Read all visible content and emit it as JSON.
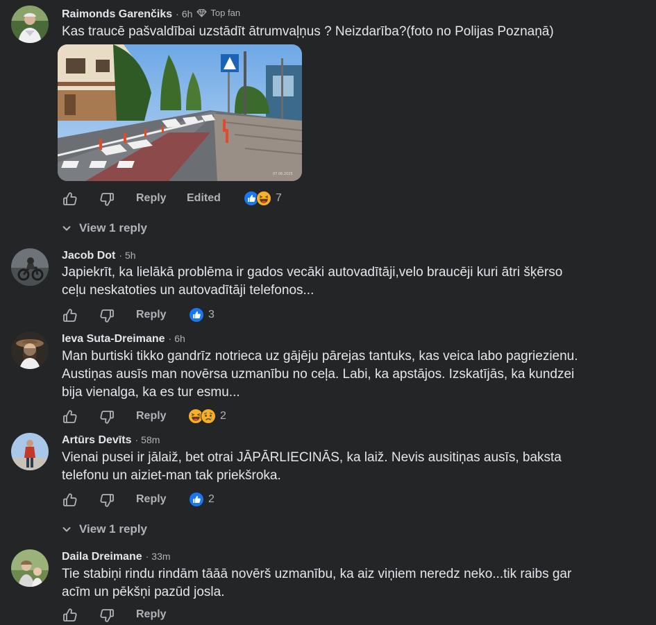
{
  "comments": [
    {
      "author": "Raimonds Garenčiks",
      "time": "6h",
      "badge": "Top fan",
      "text": "Kas traucē pašvaldībai uzstādīt ātrumvaļņus ? Neizdarība?(foto no Polijas Poznaņā)",
      "photo_caption": "07.06.2025",
      "actions": {
        "reply": "Reply",
        "edited": "Edited"
      },
      "reactions": {
        "types": [
          "like-icon",
          "laughing-face-icon"
        ],
        "count": "7"
      },
      "view_replies": "View 1 reply"
    },
    {
      "author": "Jacob Dot",
      "time": "5h",
      "text_lines": [
        "Japiekrīt, ka lielākā problēma ir gados vecāki autovadītāji,velo braucēji kuri ātri šķērso",
        "ceļu neskatoties un autovadītāji telefonos..."
      ],
      "actions": {
        "reply": "Reply"
      },
      "reactions": {
        "types": [
          "like-icon"
        ],
        "count": "3"
      }
    },
    {
      "author": "Ieva Suta-Dreimane",
      "time": "6h",
      "text_lines": [
        "Man burtiski tikko gandrīz notrieca uz gājēju pārejas tantuks, kas veica labo pagriezienu.",
        "Austiņas ausīs man novērsa uzmanību no ceļa. Labi, ka apstājos. Izskatījās, ka kundzei",
        "bija vienalga, ka es tur esmu..."
      ],
      "actions": {
        "reply": "Reply"
      },
      "reactions": {
        "types": [
          "laughing-face-icon",
          "sad-face-icon"
        ],
        "count": "2"
      }
    },
    {
      "author": "Artūrs Devīts",
      "time": "58m",
      "text_lines": [
        "Vienai pusei ir jālaiž, bet otrai JĀPĀRLIECINĀS, ka laiž. Nevis ausitiņas ausīs, baksta",
        "telefonu un aiziet-man tak priekšroka."
      ],
      "actions": {
        "reply": "Reply"
      },
      "reactions": {
        "types": [
          "like-icon"
        ],
        "count": "2"
      },
      "view_replies": "View 1 reply"
    },
    {
      "author": "Daila Dreimane",
      "time": "33m",
      "text_lines": [
        "Tie stabiņi rindu rindām tāāā novērš uzmanību, ka aiz viņiem neredz neko...tik raibs gar",
        "acīm un pēkšņi pazūd josla."
      ],
      "actions": {
        "reply": "Reply"
      }
    }
  ],
  "colors": {
    "background": "#242526",
    "text_primary": "#e4e6eb",
    "text_secondary": "#b0b3b8",
    "like_blue": "#1877f2",
    "emoji_yellow": "#f7b125"
  }
}
